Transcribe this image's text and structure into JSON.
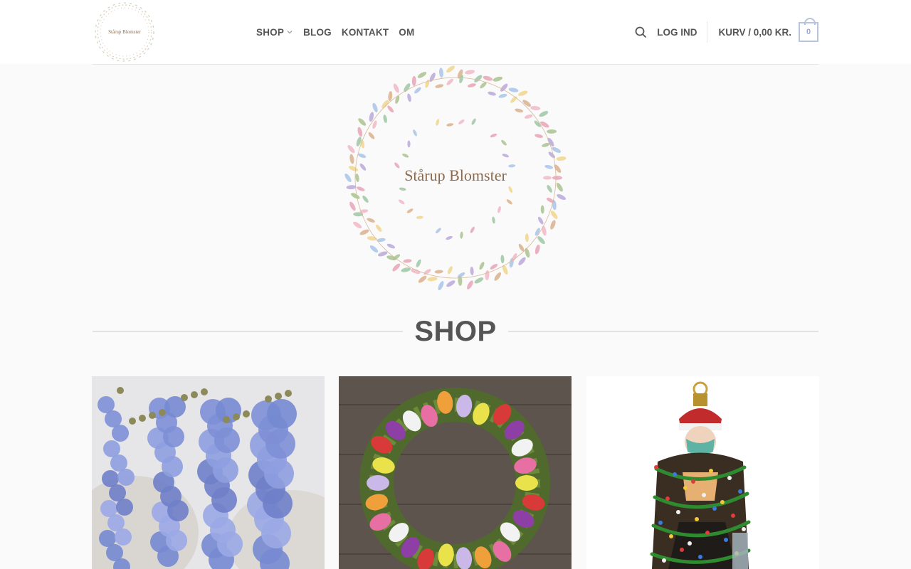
{
  "header": {
    "logo_text": "Stårup Blomster",
    "nav": [
      {
        "label": "SHOP",
        "has_dropdown": true
      },
      {
        "label": "BLOG"
      },
      {
        "label": "KONTAKT"
      },
      {
        "label": "OM"
      }
    ],
    "login_label": "LOG IND",
    "cart_label": "KURV / 0,00 KR.",
    "cart_count": "0"
  },
  "hero": {
    "logo_text": "Stårup Blomster"
  },
  "main": {
    "heading": "SHOP"
  },
  "products": [
    {
      "image": "blue-scabiosa-bouquet"
    },
    {
      "image": "tulip-wreath"
    },
    {
      "image": "santa-ornament"
    }
  ],
  "colors": {
    "accent": "#b7c4e0",
    "text": "#555555",
    "background": "#fafafa"
  },
  "icons": [
    "search-icon",
    "chevron-down-icon",
    "cart-icon"
  ]
}
